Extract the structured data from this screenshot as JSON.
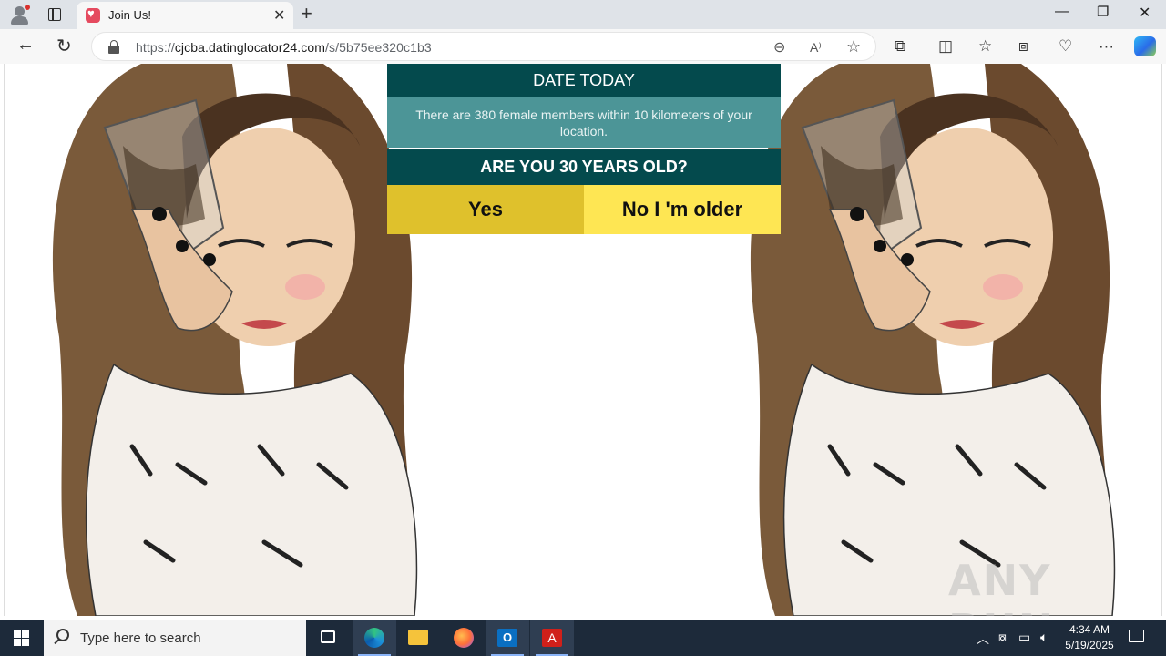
{
  "browser": {
    "tab_title": "Join Us!",
    "url_scheme": "https://",
    "url_host": "cjcba.datinglocator24.com",
    "url_path": "/s/5b75ee320c1b3"
  },
  "page": {
    "title": "DATE TODAY",
    "info": "There are 380 female members within 10 kilometers of your location.",
    "question": "ARE YOU 30 YEARS OLD?",
    "yes_label": "Yes",
    "no_label": "No I 'm older",
    "watermark": "ANY RUN",
    "colors": {
      "title_bg": "#044a4d",
      "info_bg": "#4c9597",
      "yes_bg": "#dfc12c",
      "no_bg": "#fee653"
    }
  },
  "taskbar": {
    "search_placeholder": "Type here to search",
    "time": "4:34 AM",
    "date": "5/19/2025",
    "apps": [
      "task-view-icon",
      "edge-icon",
      "file-explorer-icon",
      "firefox-icon",
      "outlook-icon",
      "acrobat-icon"
    ]
  }
}
